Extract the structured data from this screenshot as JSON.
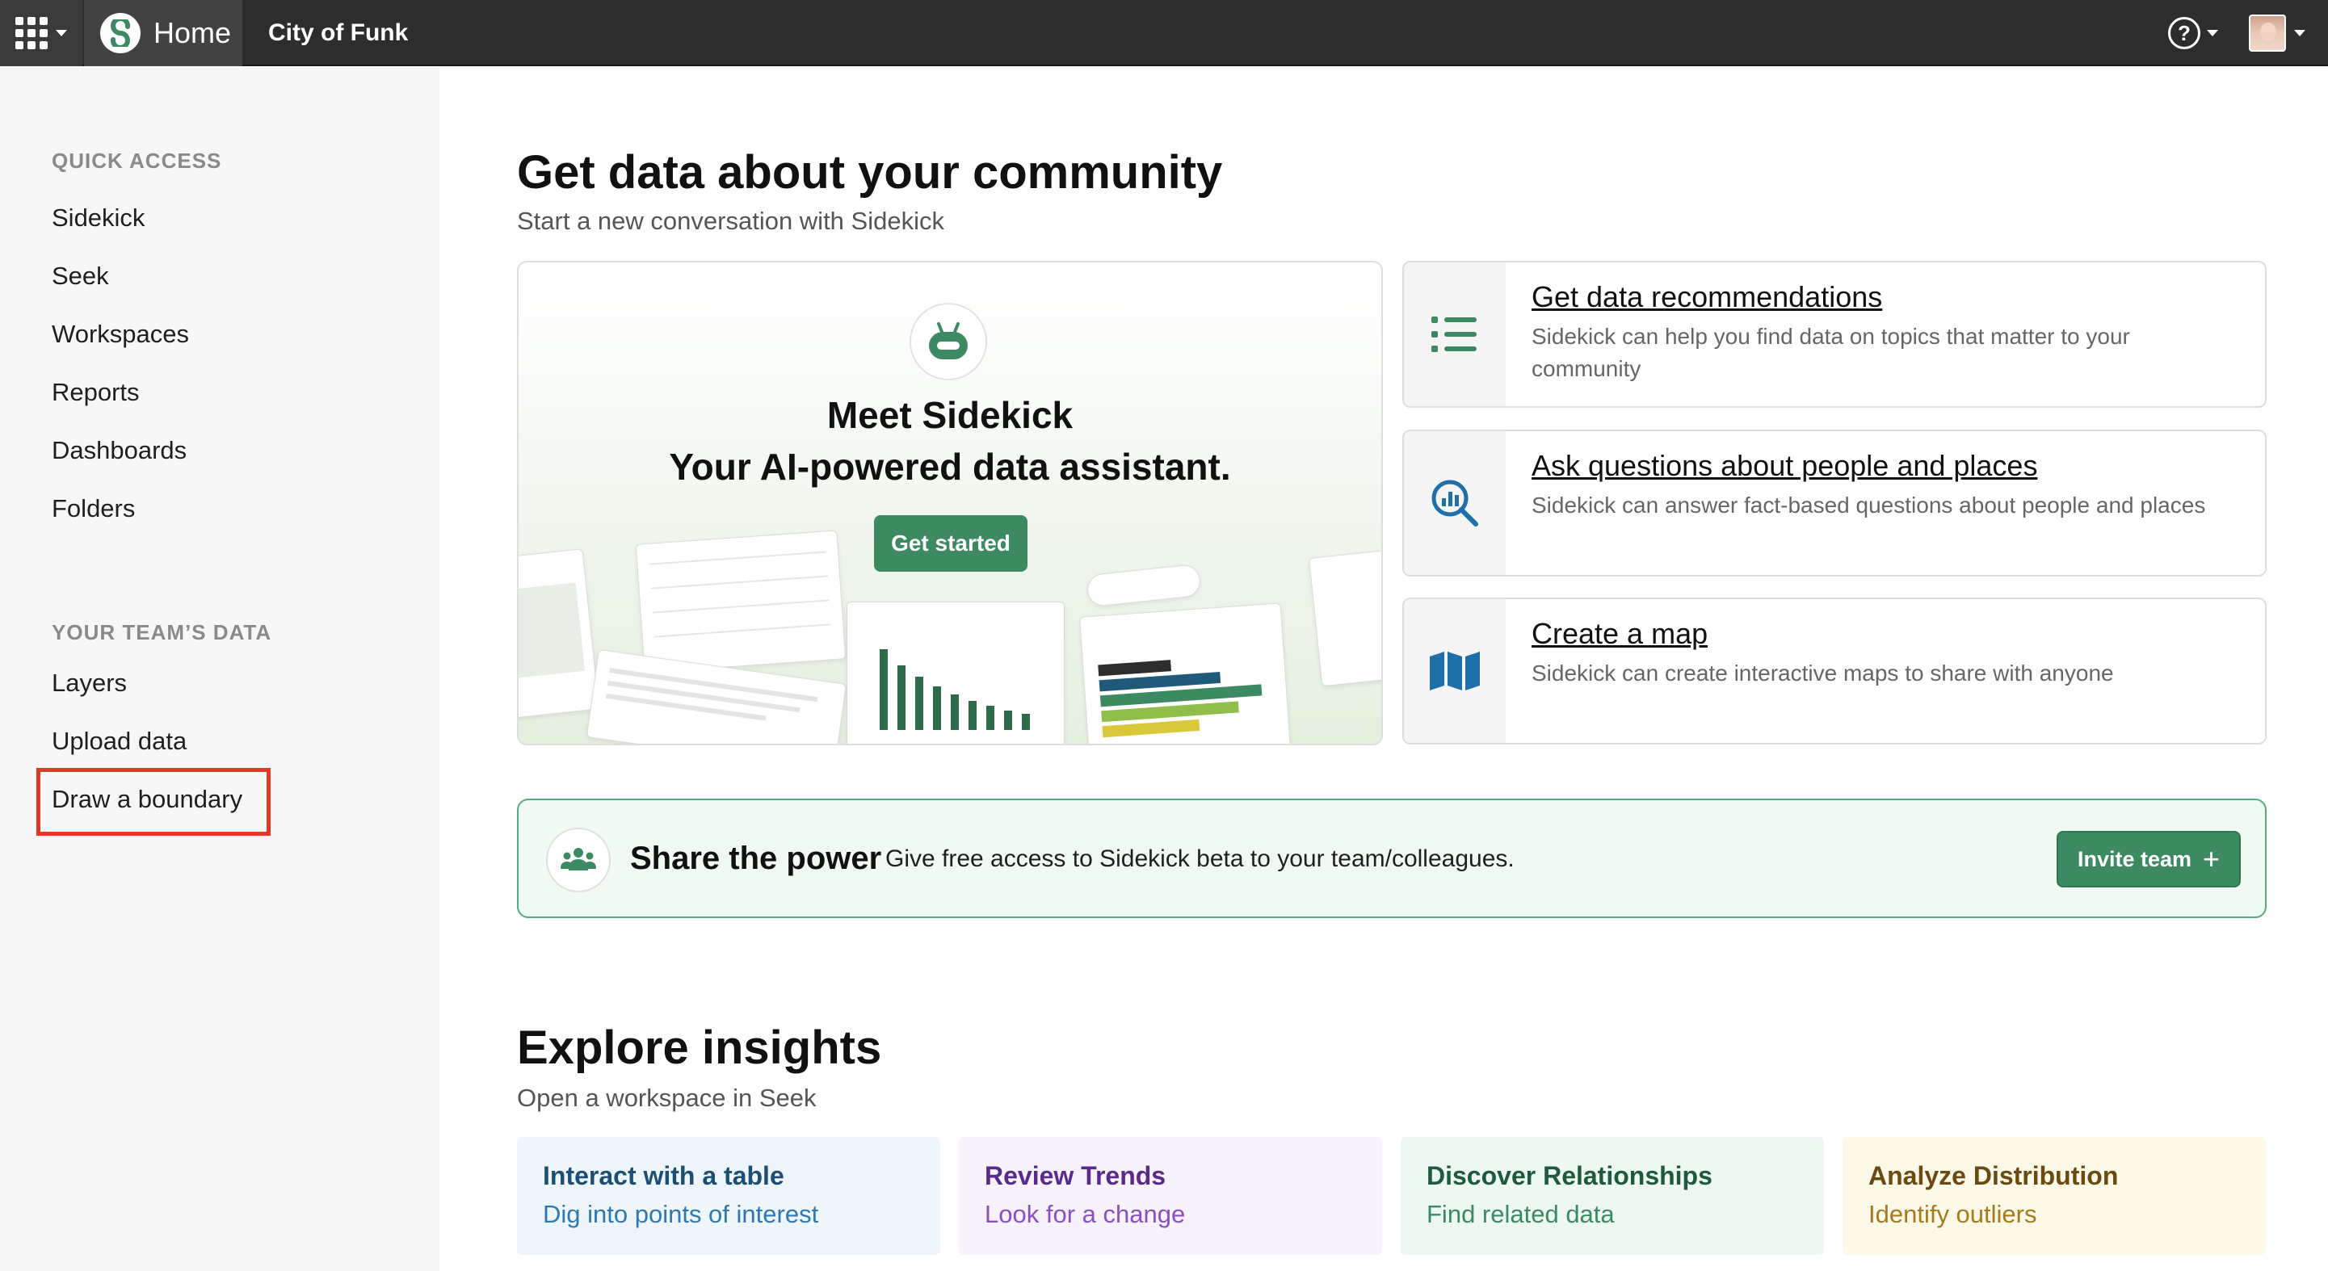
{
  "header": {
    "home_label": "Home",
    "city_name": "City of Funk",
    "help_glyph": "?",
    "apps_icon": "grid-icon",
    "logo_icon": "seek-logo-icon"
  },
  "sidebar": {
    "quick_access_title": "QUICK ACCESS",
    "quick_access": [
      {
        "label": "Sidekick"
      },
      {
        "label": "Seek"
      },
      {
        "label": "Workspaces"
      },
      {
        "label": "Reports"
      },
      {
        "label": "Dashboards"
      },
      {
        "label": "Folders"
      }
    ],
    "team_data_title": "YOUR TEAM’S DATA",
    "team_data": [
      {
        "label": "Layers"
      },
      {
        "label": "Upload data"
      },
      {
        "label": "Draw a boundary"
      }
    ]
  },
  "main": {
    "title": "Get data about your community",
    "subtitle": "Start a new conversation with Sidekick",
    "hero": {
      "line1": "Meet Sidekick",
      "line2": "Your AI-powered data assistant.",
      "button": "Get started"
    },
    "cards": [
      {
        "title": "Get data recommendations",
        "desc": "Sidekick can help you find data on topics that matter to your community",
        "icon": "list-icon"
      },
      {
        "title": "Ask questions about people and places",
        "desc": "Sidekick can answer fact-based questions about people and places",
        "icon": "chart-search-icon"
      },
      {
        "title": "Create a map",
        "desc": "Sidekick can create interactive maps to share with anyone",
        "icon": "map-icon"
      }
    ],
    "share": {
      "title": "Share the power",
      "desc": "Give free access to Sidekick beta to your team/colleagues.",
      "button": "Invite team",
      "button_glyph": "+"
    },
    "explore_title": "Explore insights",
    "explore_subtitle": "Open a workspace in Seek",
    "insights": [
      {
        "title": "Interact with a table",
        "desc": "Dig into points of interest",
        "bg": "#eef5fb",
        "title_color": "#1d4e73",
        "desc_color": "#2f79b0"
      },
      {
        "title": "Review Trends",
        "desc": "Look for a change",
        "bg": "#f7f2fc",
        "title_color": "#5a2a8a",
        "desc_color": "#8a4fc0"
      },
      {
        "title": "Discover Relationships",
        "desc": "Find related data",
        "bg": "#eef8f2",
        "title_color": "#1f5a3a",
        "desc_color": "#3d8a62"
      },
      {
        "title": "Analyze Distribution",
        "desc": "Identify outliers",
        "bg": "#fdf9e8",
        "title_color": "#6b4a12",
        "desc_color": "#a67a1f"
      }
    ]
  },
  "colors": {
    "topbar": "#2d2d2d",
    "accent_green": "#3d8a62",
    "highlight_red": "#e13a24"
  }
}
